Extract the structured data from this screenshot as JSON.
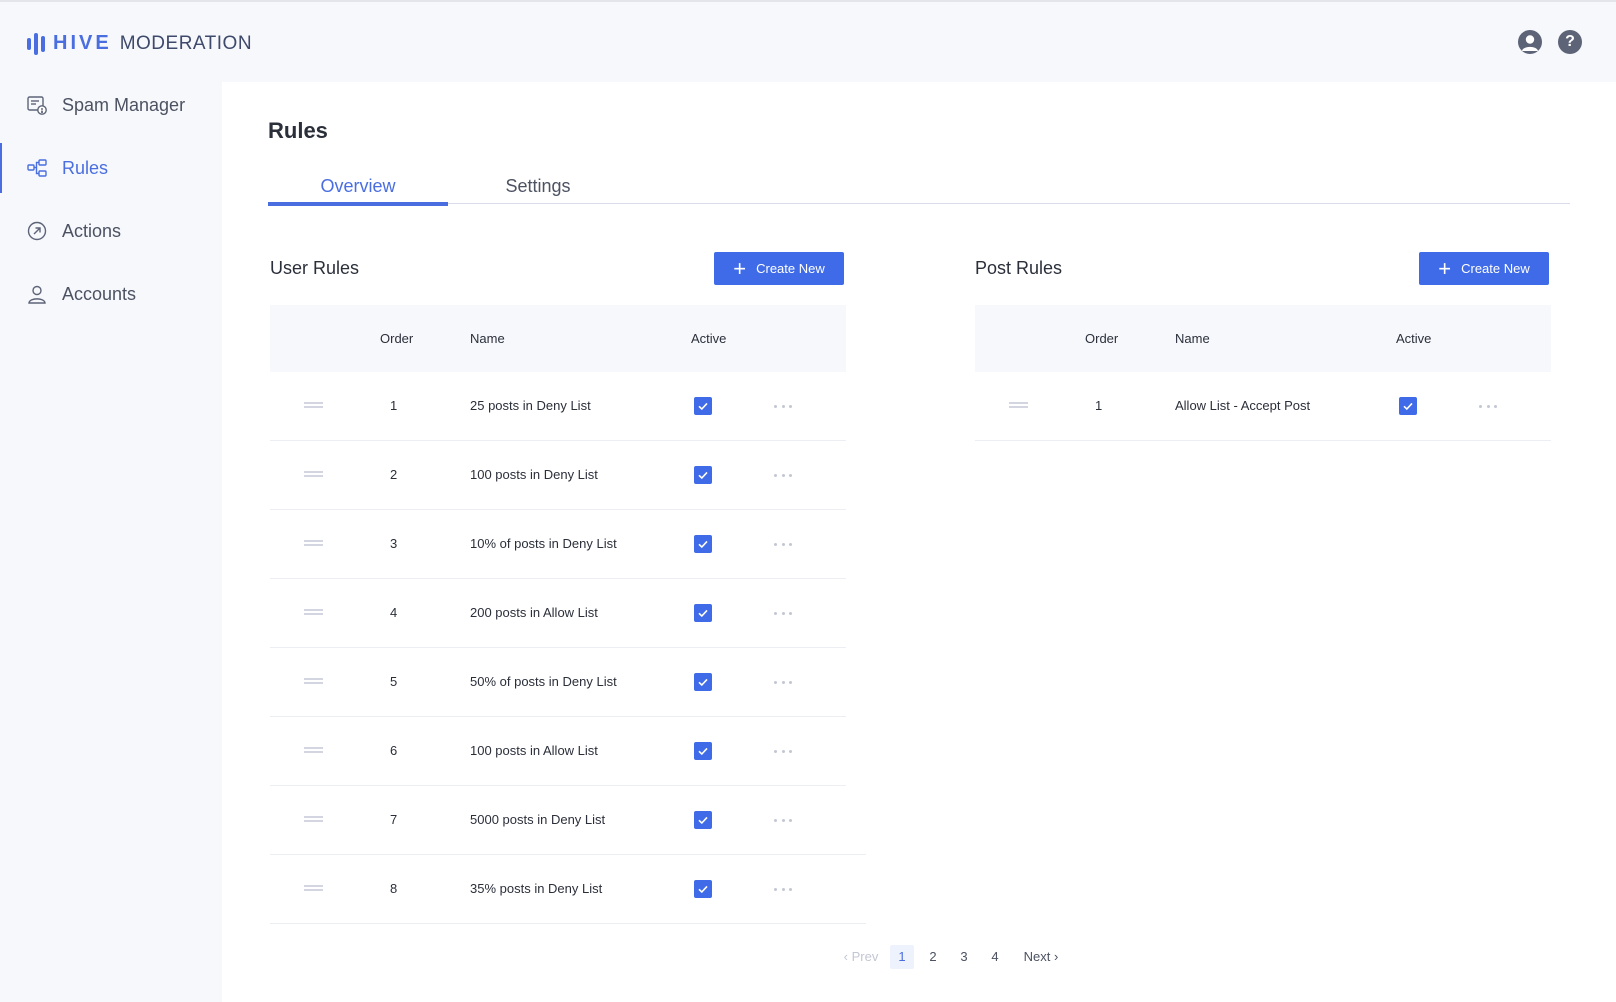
{
  "header": {
    "logo_primary": "HIVE",
    "logo_secondary": "MODERATION",
    "icons": [
      "user-account-icon",
      "help-icon"
    ],
    "help_glyph": "?"
  },
  "sidebar": {
    "items": [
      {
        "label": "Spam Manager",
        "icon": "spam-manager-icon",
        "active": false
      },
      {
        "label": "Rules",
        "icon": "rules-icon",
        "active": true
      },
      {
        "label": "Actions",
        "icon": "actions-icon",
        "active": false
      },
      {
        "label": "Accounts",
        "icon": "accounts-icon",
        "active": false
      }
    ]
  },
  "page": {
    "title": "Rules",
    "tabs": [
      {
        "label": "Overview",
        "active": true
      },
      {
        "label": "Settings",
        "active": false
      }
    ]
  },
  "user_rules": {
    "title": "User Rules",
    "create_label": "Create New",
    "columns": {
      "order": "Order",
      "name": "Name",
      "active": "Active"
    },
    "rows": [
      {
        "order": "1",
        "name": "25 posts in Deny List",
        "active": true
      },
      {
        "order": "2",
        "name": "100 posts in Deny List",
        "active": true
      },
      {
        "order": "3",
        "name": "10% of posts in Deny List",
        "active": true
      },
      {
        "order": "4",
        "name": "200 posts in Allow List",
        "active": true
      },
      {
        "order": "5",
        "name": "50% of posts in Deny List",
        "active": true
      },
      {
        "order": "6",
        "name": "100 posts in Allow List",
        "active": true
      },
      {
        "order": "7",
        "name": "5000 posts in Deny List",
        "active": true
      },
      {
        "order": "8",
        "name": "35% posts in Deny List",
        "active": true
      }
    ]
  },
  "post_rules": {
    "title": "Post Rules",
    "create_label": "Create New",
    "columns": {
      "order": "Order",
      "name": "Name",
      "active": "Active"
    },
    "rows": [
      {
        "order": "1",
        "name": "Allow List - Accept Post",
        "active": true
      }
    ]
  },
  "pagination": {
    "prev_label": "Prev",
    "next_label": "Next",
    "pages": [
      "1",
      "2",
      "3",
      "4"
    ],
    "current": "1",
    "prev_arrow": "‹",
    "next_arrow": "›"
  },
  "colors": {
    "accent": "#3f6be8",
    "sidebar_bg": "#f7f8fc",
    "panel_bg": "#ffffff"
  }
}
